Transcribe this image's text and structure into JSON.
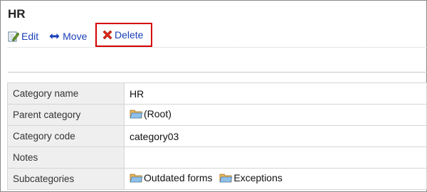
{
  "page": {
    "title": "HR"
  },
  "toolbar": {
    "edit_label": "Edit",
    "move_label": "Move",
    "delete_label": "Delete"
  },
  "details": {
    "rows": [
      {
        "label": "Category name",
        "value": "HR"
      },
      {
        "label": "Parent category",
        "value": "(Root)"
      },
      {
        "label": "Category code",
        "value": "category03"
      },
      {
        "label": "Notes",
        "value": ""
      },
      {
        "label": "Subcategories",
        "items": [
          "Outdated forms",
          "Exceptions"
        ]
      }
    ]
  },
  "icons": {
    "edit": "edit-icon",
    "move": "move-arrows-icon",
    "delete": "delete-x-icon",
    "folder": "folder-icon"
  },
  "colors": {
    "link": "#1a3fb8",
    "highlight_border": "#d40000",
    "label_bg": "#efefef"
  }
}
